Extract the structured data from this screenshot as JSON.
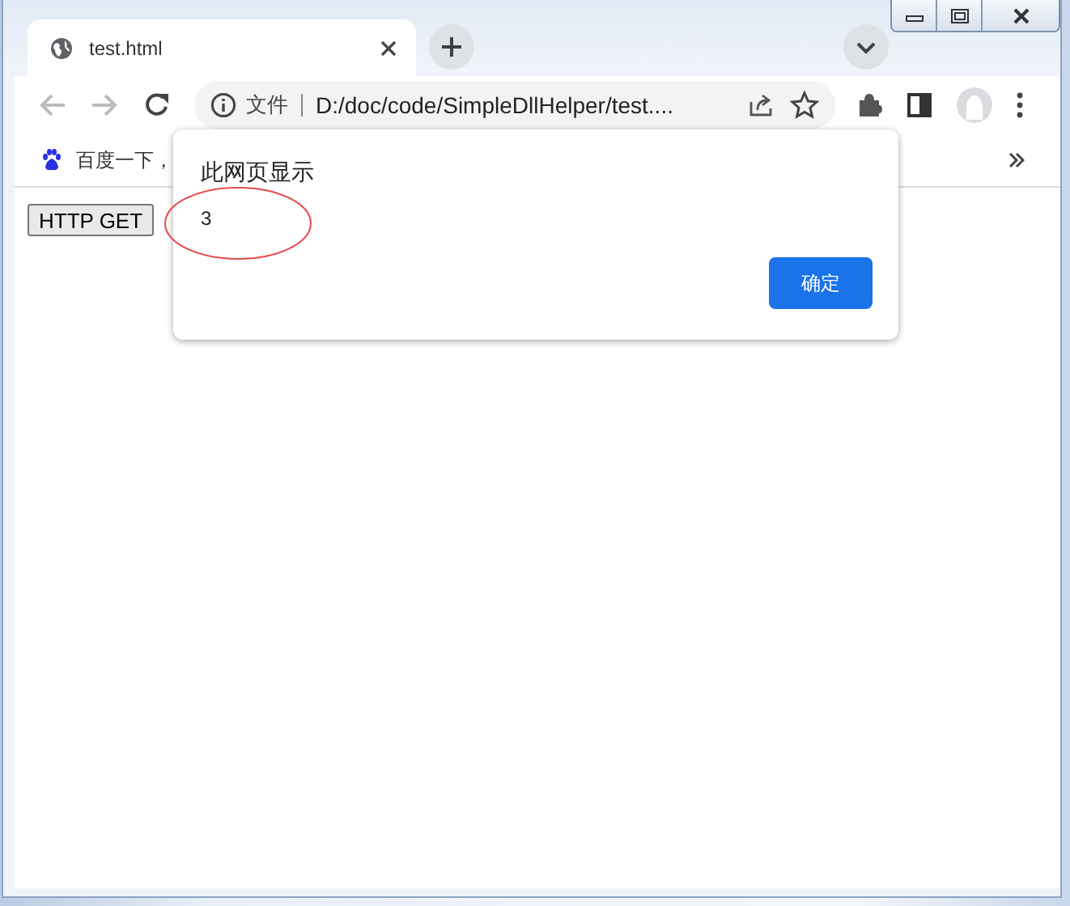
{
  "tabs": [
    {
      "title": "test.html",
      "selected": true
    }
  ],
  "address_bar": {
    "security_label": "文件",
    "url": "D:/doc/code/SimpleDllHelper/test...."
  },
  "bookmarks": [
    {
      "label": "百度一下，"
    }
  ],
  "page": {
    "buttons": [
      "HTTP GET"
    ]
  },
  "dialog": {
    "title": "此网页显示",
    "message": "3",
    "buttons": [
      "确定"
    ]
  },
  "annotations": [
    {
      "kind": "ellipse"
    }
  ]
}
